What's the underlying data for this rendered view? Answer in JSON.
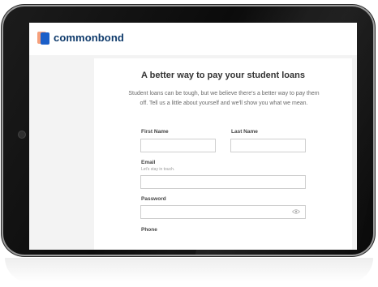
{
  "brand": {
    "name": "commonbond"
  },
  "form": {
    "title": "A better way to pay your student loans",
    "intro": "Student loans can be tough, but we believe there's a better way to pay them off. Tell us a little about yourself and we'll show you what we mean.",
    "first_name_label": "First Name",
    "last_name_label": "Last Name",
    "email_label": "Email",
    "email_hint": "Let's stay in touch.",
    "password_label": "Password",
    "phone_label": "Phone"
  },
  "colors": {
    "brand_blue": "#1c5fc9",
    "brand_orange": "#f6a07c",
    "logo_text": "#0e3a6b"
  },
  "icons": {
    "password_toggle": "eye-icon"
  }
}
